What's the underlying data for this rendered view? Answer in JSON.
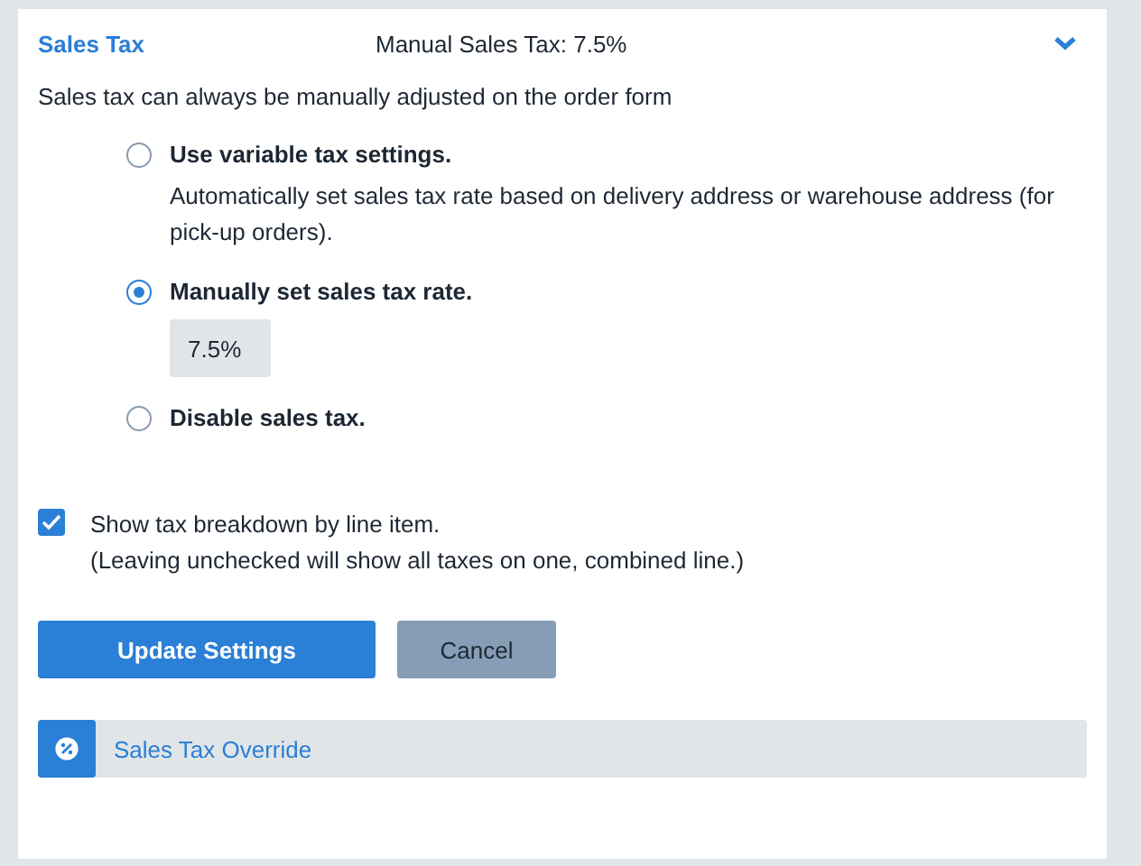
{
  "section": {
    "title": "Sales Tax",
    "summary": "Manual Sales Tax: 7.5%",
    "expanded": true
  },
  "note": "Sales tax can always be manually adjusted on the order form",
  "options": [
    {
      "label": "Use variable tax settings.",
      "description": "Automatically set sales tax rate based on delivery address or warehouse address (for pick-up orders).",
      "selected": false
    },
    {
      "label": "Manually set sales tax rate.",
      "value": "7.5%",
      "selected": true
    },
    {
      "label": "Disable sales tax.",
      "selected": false
    }
  ],
  "breakdown": {
    "label": "Show tax breakdown by line item.",
    "hint": "(Leaving unchecked will show all taxes on one, combined line.)",
    "checked": true
  },
  "buttons": [
    {
      "label": "Update Settings",
      "kind": "primary"
    },
    {
      "label": "Cancel",
      "kind": "secondary"
    }
  ],
  "override": {
    "label": "Sales Tax Override"
  }
}
